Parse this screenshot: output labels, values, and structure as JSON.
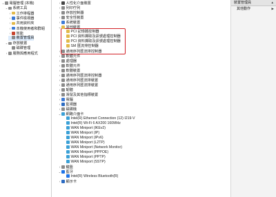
{
  "left_tree": [
    {
      "label": "電腦管理 (本機)",
      "indent": 0,
      "exp": "⌄",
      "icon": "computer-icon",
      "color": "c-gray"
    },
    {
      "label": "系統工具",
      "indent": 1,
      "exp": "⌄",
      "icon": "tools-icon",
      "color": "c-gray"
    },
    {
      "label": "工作排程器",
      "indent": 2,
      "exp": "›",
      "icon": "task-scheduler-icon",
      "color": "c-yel"
    },
    {
      "label": "事件檢視器",
      "indent": 2,
      "exp": "›",
      "icon": "event-viewer-icon",
      "color": "c-blue"
    },
    {
      "label": "共用資料夾",
      "indent": 2,
      "exp": "›",
      "icon": "folder-icon",
      "color": "c-yel"
    },
    {
      "label": "本機使用者和群組",
      "indent": 2,
      "exp": "›",
      "icon": "users-icon",
      "color": "c-blue"
    },
    {
      "label": "效能",
      "indent": 2,
      "exp": "›",
      "icon": "performance-icon",
      "color": "c-red"
    },
    {
      "label": "裝置管理員",
      "indent": 2,
      "exp": "",
      "icon": "device-manager-icon",
      "color": "c-gray",
      "selected": true
    },
    {
      "label": "存放裝置",
      "indent": 1,
      "exp": "⌄",
      "icon": "storage-icon",
      "color": "c-gray"
    },
    {
      "label": "磁碟管理",
      "indent": 2,
      "exp": "",
      "icon": "disk-icon",
      "color": "c-gray"
    },
    {
      "label": "服務與應用程式",
      "indent": 1,
      "exp": "›",
      "icon": "services-icon",
      "color": "c-gray"
    }
  ],
  "device_tree": [
    {
      "label": "人性化介面裝置",
      "indent": 1,
      "exp": "›",
      "icon": "hid-icon",
      "color": "c-dark"
    },
    {
      "label": "列印佇列",
      "indent": 1,
      "exp": "›",
      "icon": "print-queue-icon",
      "color": "c-gray"
    },
    {
      "label": "存放控制器",
      "indent": 1,
      "exp": "›",
      "icon": "storage-controller-icon",
      "color": "c-gray"
    },
    {
      "label": "安全性裝置",
      "indent": 1,
      "exp": "›",
      "icon": "security-icon",
      "color": "c-gray"
    },
    {
      "label": "系統裝置",
      "indent": 1,
      "exp": "›",
      "icon": "system-icon",
      "color": "c-blue"
    },
    {
      "label": "其他裝置",
      "indent": 1,
      "exp": "⌄",
      "icon": "other-devices-icon",
      "color": "c-yel"
    },
    {
      "label": "PCI 記憶體控制器",
      "indent": 2,
      "exp": "",
      "icon": "warning-device-icon",
      "color": "c-yel",
      "highlight": true
    },
    {
      "label": "PCI 資料擷取及訊號處理控制器",
      "indent": 2,
      "exp": "",
      "icon": "warning-device-icon",
      "color": "c-yel",
      "highlight": true
    },
    {
      "label": "PCI 資料擷取及訊號處理控制器",
      "indent": 2,
      "exp": "",
      "icon": "warning-device-icon",
      "color": "c-yel",
      "highlight": true
    },
    {
      "label": "SM 匯流排控制器",
      "indent": 2,
      "exp": "",
      "icon": "warning-device-icon",
      "color": "c-yel",
      "highlight": true
    },
    {
      "label": "通用序列匯流排控制器",
      "indent": 1,
      "exp": "›",
      "icon": "usb-icon",
      "color": "c-gray"
    },
    {
      "label": "軟體元件",
      "indent": 1,
      "exp": "›",
      "icon": "software-component-icon",
      "color": "c-gray"
    },
    {
      "label": "處理器",
      "indent": 1,
      "exp": "›",
      "icon": "processor-icon",
      "color": "c-gray"
    },
    {
      "label": "軟體元件",
      "indent": 1,
      "exp": "›",
      "icon": "software-component-icon",
      "color": "c-gray"
    },
    {
      "label": "軟體裝置",
      "indent": 1,
      "exp": "›",
      "icon": "software-device-icon",
      "color": "c-gray"
    },
    {
      "label": "通用序列匯流排控制器",
      "indent": 1,
      "exp": "›",
      "icon": "usb-icon",
      "color": "c-gray"
    },
    {
      "label": "通用序列匯流排裝置",
      "indent": 1,
      "exp": "›",
      "icon": "usb-device-icon",
      "color": "c-gray"
    },
    {
      "label": "通用序列匯流排裝置",
      "indent": 1,
      "exp": "›",
      "icon": "usb-device-icon",
      "color": "c-gray"
    },
    {
      "label": "韌體",
      "indent": 1,
      "exp": "›",
      "icon": "firmware-icon",
      "color": "c-gray"
    },
    {
      "label": "滑鼠及其他指標裝置",
      "indent": 1,
      "exp": "›",
      "icon": "mouse-icon",
      "color": "c-gray"
    },
    {
      "label": "電腦",
      "indent": 1,
      "exp": "›",
      "icon": "computer-icon",
      "color": "c-blue"
    },
    {
      "label": "監視器",
      "indent": 1,
      "exp": "›",
      "icon": "monitor-icon",
      "color": "c-mon"
    },
    {
      "label": "磁碟機",
      "indent": 1,
      "exp": "›",
      "icon": "disk-drive-icon",
      "color": "c-gray"
    },
    {
      "label": "網路介面卡",
      "indent": 1,
      "exp": "⌄",
      "icon": "network-adapter-icon",
      "color": "c-net"
    },
    {
      "label": "Intel(R) Ethernet Connection (12) I219-V",
      "indent": 2,
      "exp": "",
      "icon": "network-adapter-icon",
      "color": "c-net"
    },
    {
      "label": "Intel(R) Wi-Fi 6 AX200 160MHz",
      "indent": 2,
      "exp": "",
      "icon": "network-adapter-icon",
      "color": "c-net"
    },
    {
      "label": "WAN Miniport (IKEv2)",
      "indent": 2,
      "exp": "",
      "icon": "network-adapter-icon",
      "color": "c-net"
    },
    {
      "label": "WAN Miniport (IP)",
      "indent": 2,
      "exp": "",
      "icon": "network-adapter-icon",
      "color": "c-net"
    },
    {
      "label": "WAN Miniport (IPv6)",
      "indent": 2,
      "exp": "",
      "icon": "network-adapter-icon",
      "color": "c-net"
    },
    {
      "label": "WAN Miniport (L2TP)",
      "indent": 2,
      "exp": "",
      "icon": "network-adapter-icon",
      "color": "c-net"
    },
    {
      "label": "WAN Miniport (Network Monitor)",
      "indent": 2,
      "exp": "",
      "icon": "network-adapter-icon",
      "color": "c-net"
    },
    {
      "label": "WAN Miniport (PPPOE)",
      "indent": 2,
      "exp": "",
      "icon": "network-adapter-icon",
      "color": "c-net"
    },
    {
      "label": "WAN Miniport (PPTP)",
      "indent": 2,
      "exp": "",
      "icon": "network-adapter-icon",
      "color": "c-net"
    },
    {
      "label": "WAN Miniport (SSTP)",
      "indent": 2,
      "exp": "",
      "icon": "network-adapter-icon",
      "color": "c-net"
    },
    {
      "label": "鍵盤",
      "indent": 1,
      "exp": "›",
      "icon": "keyboard-icon",
      "color": "c-gray"
    },
    {
      "label": "藍牙",
      "indent": 1,
      "exp": "⌄",
      "icon": "bluetooth-icon",
      "color": "c-bt"
    },
    {
      "label": "Intel(R) Wireless Bluetooth(R)",
      "indent": 2,
      "exp": "",
      "icon": "bluetooth-icon",
      "color": "c-bt"
    },
    {
      "label": "顯示卡",
      "indent": 1,
      "exp": "›",
      "icon": "display-adapter-icon",
      "color": "c-mon"
    }
  ],
  "actions": {
    "header": "裝置管理員",
    "more_actions": "其他動作"
  }
}
